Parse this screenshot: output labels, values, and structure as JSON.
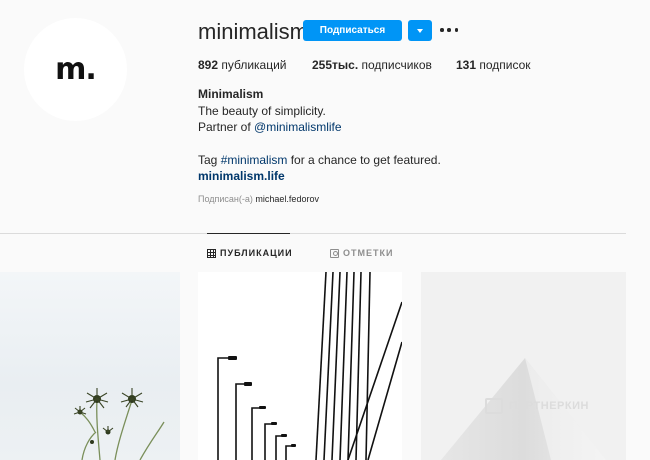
{
  "profile": {
    "avatar_text": "m.",
    "username": "minimalism",
    "follow_label": "Подписаться",
    "stats": {
      "posts_count": "892",
      "posts_label": "публикаций",
      "followers_count": "255тыс.",
      "followers_label": "подписчиков",
      "following_count": "131",
      "following_label": "подписок"
    },
    "bio": {
      "name": "Minimalism",
      "line1": "The beauty of simplicity.",
      "line2_prefix": "Partner of ",
      "line2_link": "@minimalismlife",
      "line3_prefix": "Tag ",
      "line3_hashtag": "#minimalism",
      "line3_suffix": " for a chance to get featured.",
      "website": "minimalism.life"
    },
    "followed_by_prefix": "Подписан(-а)",
    "followed_by_user": "michael.fedorov"
  },
  "tabs": {
    "posts": "ПУБЛИКАЦИИ",
    "tagged": "ОТМЕТКИ"
  },
  "watermark": "ПАРТНЕРКИН",
  "colors": {
    "primary_button": "#0095f6",
    "link": "#00376b",
    "muted_text": "#8e8e8e"
  }
}
